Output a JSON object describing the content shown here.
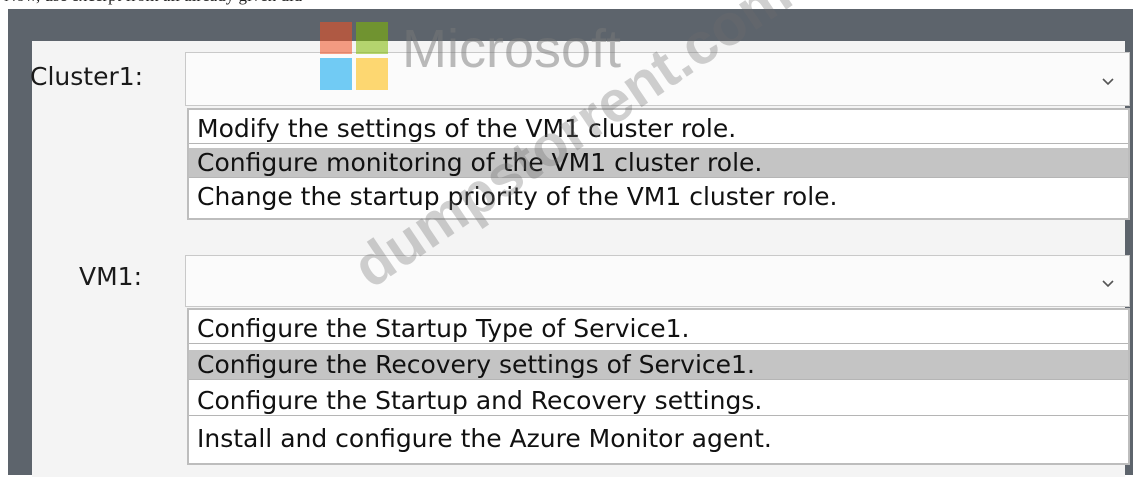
{
  "caption": "Now, use excerpt from all already given did",
  "watermark": {
    "logo_text": "Microsoft",
    "diagonal_text": "dumpstorrent.com",
    "logo_colors": [
      "#f25022",
      "#7fba00",
      "#00a4ef",
      "#ffb900"
    ]
  },
  "cluster1": {
    "label": "Cluster1:",
    "selected_value": "",
    "options": [
      "Modify the settings of the VM1 cluster role.",
      "Configure monitoring of the VM1 cluster role.",
      "Change the startup priority of the VM1 cluster role."
    ],
    "highlighted_index": 1
  },
  "vm1": {
    "label": "VM1:",
    "selected_value": "",
    "options": [
      "Configure the Startup Type of Service1.",
      "Configure the Recovery settings of Service1.",
      "Configure the Startup and Recovery settings.",
      "Install and configure the Azure Monitor agent."
    ],
    "highlighted_index": 1
  },
  "colors": {
    "frame": "#5d646c",
    "panel": "#f4f4f4",
    "highlight": "#c4c4c4"
  }
}
